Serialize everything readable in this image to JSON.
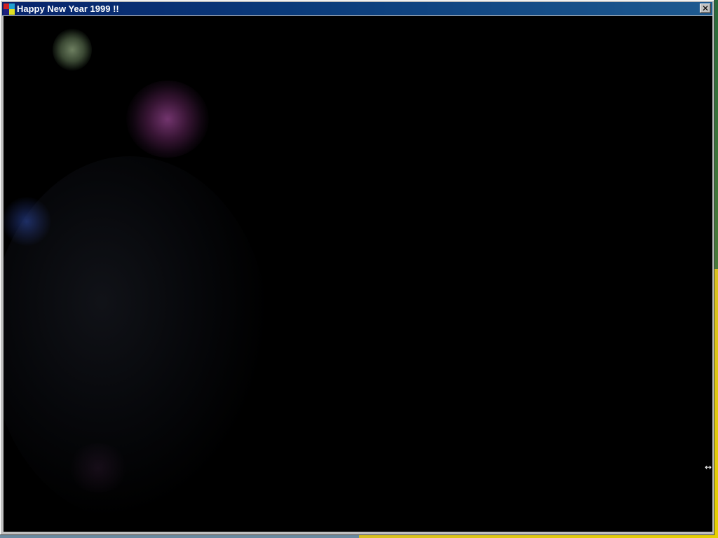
{
  "window": {
    "title": "Happy New Year 1999 !!",
    "app_icon": "fireworks-app-icon",
    "close_button": {
      "icon": "close-icon",
      "label": "✕"
    }
  },
  "canvas": {
    "background": "#000000",
    "content": "fireworks animation",
    "bursts": [
      {
        "name": "firework-burst-green",
        "color": "#c8e8b0"
      },
      {
        "name": "firework-burst-pink",
        "color": "#d060c8"
      },
      {
        "name": "firework-burst-blue",
        "color": "#3050b8"
      },
      {
        "name": "firework-debris",
        "color": "#6a7890"
      }
    ]
  },
  "colors": {
    "titlebar_start": "#08246b",
    "titlebar_end": "#1e5a90",
    "window_frame": "#c0c0c0"
  },
  "cursor": {
    "icon": "resize-horizontal-cursor-icon",
    "glyph": "↔"
  }
}
